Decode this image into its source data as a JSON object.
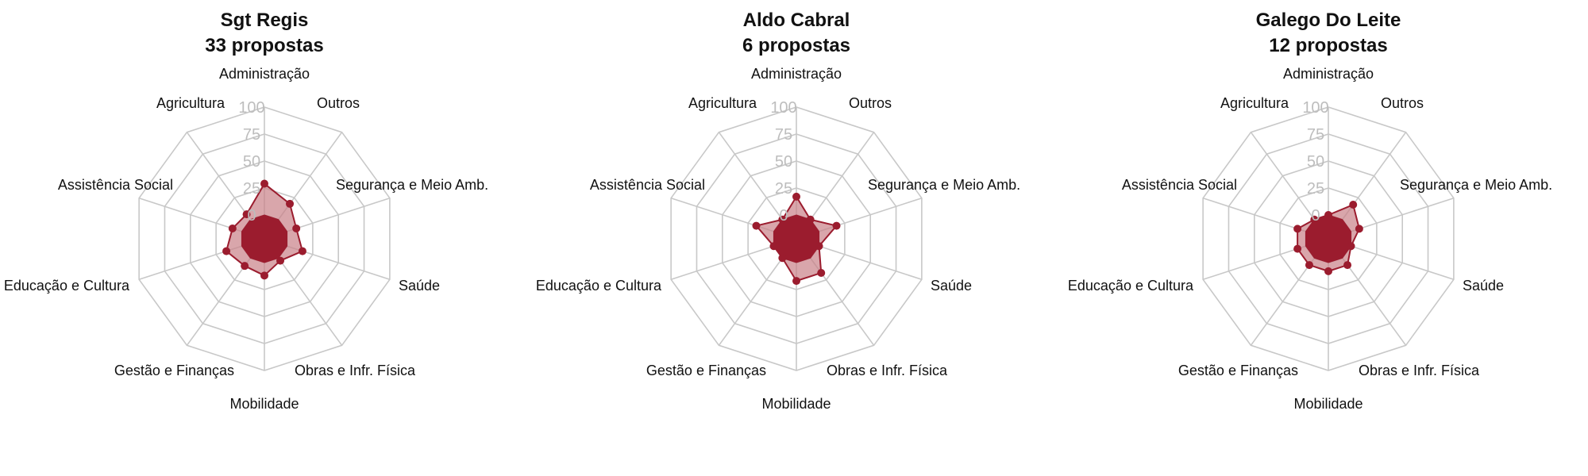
{
  "chart_data": [
    {
      "type": "radar",
      "title": "Sgt Regis",
      "subtitle": "33 propostas",
      "categories": [
        "Administração",
        "Outros",
        "Segurança e Meio Amb.",
        "Saúde",
        "Obras e Infr. Física",
        "Mobilidade",
        "Gestão e Finanças",
        "Educação e Cultura",
        "Assistência Social",
        "Agricultura"
      ],
      "values": [
        29,
        18,
        9,
        15,
        3,
        12,
        9,
        15,
        9,
        6
      ],
      "rlim": [
        0,
        100
      ],
      "ticks": [
        "0",
        "25",
        "50",
        "75",
        "100"
      ]
    },
    {
      "type": "radar",
      "title": "Aldo Cabral",
      "subtitle": "6 propostas",
      "categories": [
        "Administração",
        "Outros",
        "Segurança e Meio Amb.",
        "Saúde",
        "Obras e Infr. Física",
        "Mobilidade",
        "Gestão e Finanças",
        "Educação e Cultura",
        "Assistência Social",
        "Agricultura"
      ],
      "values": [
        17,
        0,
        17,
        0,
        17,
        17,
        0,
        0,
        17,
        0
      ],
      "rlim": [
        0,
        100
      ],
      "ticks": [
        "0",
        "25",
        "50",
        "75",
        "100"
      ]
    },
    {
      "type": "radar",
      "title": "Galego Do Leite",
      "subtitle": "12 propostas",
      "categories": [
        "Administração",
        "Outros",
        "Segurança e Meio Amb.",
        "Saúde",
        "Obras e Infr. Física",
        "Mobilidade",
        "Gestão e Finanças",
        "Educação e Cultura",
        "Assistência Social",
        "Agricultura"
      ],
      "values": [
        0,
        17,
        8,
        0,
        8,
        8,
        8,
        8,
        8,
        0
      ],
      "rlim": [
        0,
        100
      ],
      "ticks": [
        "0",
        "25",
        "50",
        "75",
        "100"
      ]
    }
  ],
  "colors": {
    "series": "#9b1c2e",
    "fill": "#c98088",
    "grid": "#c8c8c8",
    "tick_text": "#bdbdbd"
  }
}
